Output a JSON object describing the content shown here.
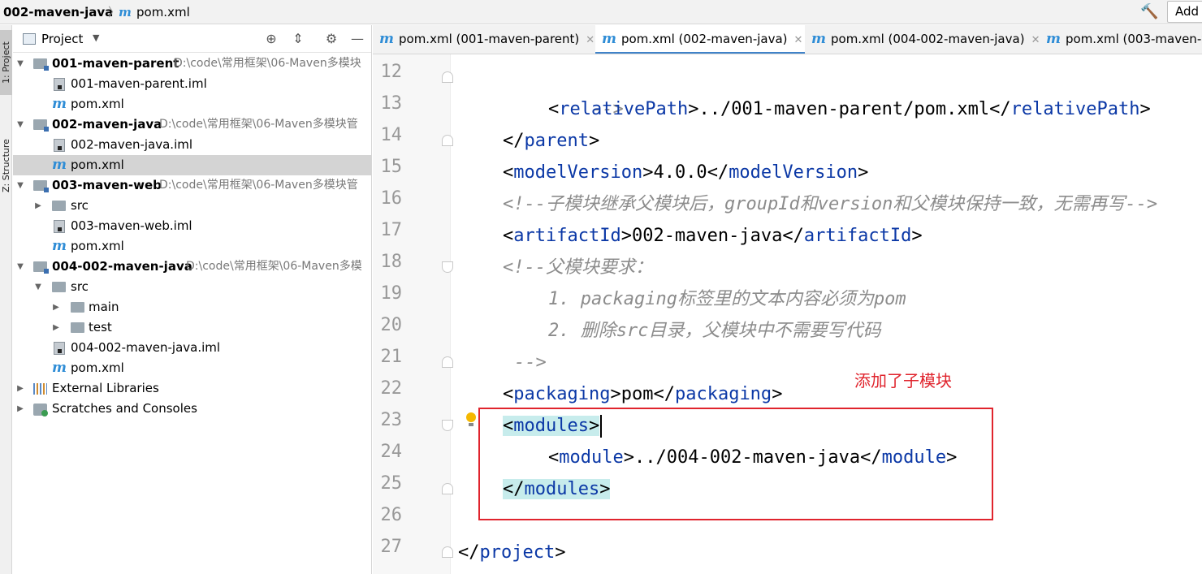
{
  "navbar": {
    "project": "002-maven-java",
    "separator": "〉",
    "file_icon": "m",
    "file": "pom.xml",
    "build_icon": "hammer-icon",
    "add_config": "Add"
  },
  "tool_strip": {
    "project_tab": "1: Project",
    "structure_tab": "Z: Structure"
  },
  "project_panel": {
    "title": "Project",
    "header_icons": [
      "target-icon",
      "collapse-icon",
      "gear-icon",
      "minimize-icon"
    ],
    "tree": [
      {
        "kind": "module",
        "name": "001-maven-parent",
        "path": "D:\\code\\常用框架\\06-Maven多模块"
      },
      {
        "kind": "iml",
        "name": "001-maven-parent.iml"
      },
      {
        "kind": "pom",
        "name": "pom.xml"
      },
      {
        "kind": "module",
        "name": "002-maven-java",
        "path": "D:\\code\\常用框架\\06-Maven多模块管"
      },
      {
        "kind": "iml",
        "name": "002-maven-java.iml"
      },
      {
        "kind": "pom",
        "name": "pom.xml"
      },
      {
        "kind": "module",
        "name": "003-maven-web",
        "path": "D:\\code\\常用框架\\06-Maven多模块管"
      },
      {
        "kind": "folder",
        "name": "src"
      },
      {
        "kind": "iml",
        "name": "003-maven-web.iml"
      },
      {
        "kind": "pom",
        "name": "pom.xml"
      },
      {
        "kind": "module",
        "name": "004-002-maven-java",
        "path": "D:\\code\\常用框架\\06-Maven多模"
      },
      {
        "kind": "folder",
        "name": "src"
      },
      {
        "kind": "folder",
        "name": "main"
      },
      {
        "kind": "folder",
        "name": "test"
      },
      {
        "kind": "iml",
        "name": "004-002-maven-java.iml"
      },
      {
        "kind": "pom",
        "name": "pom.xml"
      },
      {
        "kind": "libs",
        "name": "External Libraries"
      },
      {
        "kind": "scratch",
        "name": "Scratches and Consoles"
      }
    ]
  },
  "editor_tabs": [
    {
      "label": "pom.xml (001-maven-parent)",
      "active": false
    },
    {
      "label": "pom.xml (002-maven-java)",
      "active": true
    },
    {
      "label": "pom.xml (004-002-maven-java)",
      "active": false
    },
    {
      "label": "pom.xml (003-maven-web)",
      "active": false
    }
  ],
  "editor": {
    "line_numbers": [
      "12",
      "13",
      "14",
      "15",
      "16",
      "17",
      "18",
      "19",
      "20",
      "21",
      "22",
      "23",
      "24",
      "25",
      "26",
      "27"
    ],
    "code": {
      "l12": "-->",
      "l13_tag": "relativePath",
      "l13_text": "../001-maven-parent/pom.xml",
      "l14_tag": "parent",
      "l15_tag": "modelVersion",
      "l15_text": "4.0.0",
      "l16_comment": "<!--子模块继承父模块后，groupId和version和父模块保持一致，无需再写-->",
      "l17_tag": "artifactId",
      "l17_text": "002-maven-java",
      "l18_comment": "<!--父模块要求：",
      "l19_comment": "1. packaging标签里的文本内容必须为pom",
      "l20_comment": "2. 删除src目录，父模块中不需要写代码",
      "l21_comment": "-->",
      "l22_tag": "packaging",
      "l22_text": "pom",
      "l23_tag": "modules",
      "l24_tag": "module",
      "l24_text": "../004-002-maven-java",
      "l25_tag": "modules",
      "l27_tag": "project"
    },
    "annotation": "添加了子模块",
    "annotation_color": "#e0242d",
    "tag_color": "#0b38a6",
    "comment_color": "#8c8c8c",
    "highlight_color": "#c7ecec"
  }
}
